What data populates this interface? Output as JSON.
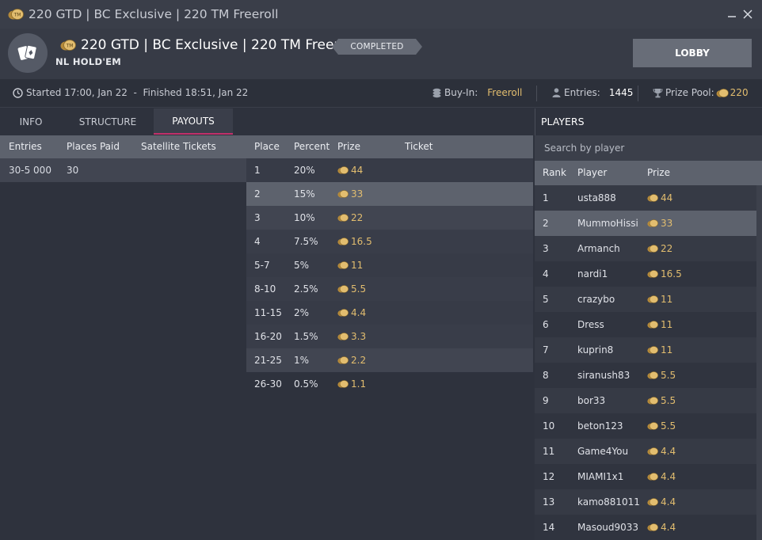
{
  "window": {
    "title": "220 GTD | BC Exclusive | 220 TM  Freeroll",
    "coin_label": "TM"
  },
  "header": {
    "title": "220 GTD | BC Exclusive | 220 TM  Freeroll",
    "status_badge": "COMPLETED",
    "game_type": "NL HOLD'EM",
    "lobby_label": "LOBBY"
  },
  "info": {
    "times": "Started 17:00, Jan 22  -  Finished 18:51, Jan 22",
    "buyin_label": "Buy-In:",
    "buyin_value": "Freeroll",
    "entries_label": "Entries:",
    "entries_value": "1445",
    "prize_pool_label": "Prize Pool:",
    "prize_pool_value": "220"
  },
  "tabs": [
    "INFO",
    "STRUCTURE",
    "PAYOUTS"
  ],
  "active_tab": "PAYOUTS",
  "payout_columns": {
    "entries": "Entries",
    "places_paid": "Places Paid",
    "satellite": "Satellite Tickets",
    "place": "Place",
    "percent": "Percent",
    "prize": "Prize",
    "ticket": "Ticket"
  },
  "entries_table": [
    {
      "entries": "30-5 000",
      "places_paid": "30",
      "satellite": ""
    }
  ],
  "payouts": [
    {
      "place": "1",
      "percent": "20%",
      "prize": "44"
    },
    {
      "place": "2",
      "percent": "15%",
      "prize": "33"
    },
    {
      "place": "3",
      "percent": "10%",
      "prize": "22"
    },
    {
      "place": "4",
      "percent": "7.5%",
      "prize": "16.5"
    },
    {
      "place": "5-7",
      "percent": "5%",
      "prize": "11"
    },
    {
      "place": "8-10",
      "percent": "2.5%",
      "prize": "5.5"
    },
    {
      "place": "11-15",
      "percent": "2%",
      "prize": "4.4"
    },
    {
      "place": "16-20",
      "percent": "1.5%",
      "prize": "3.3"
    },
    {
      "place": "21-25",
      "percent": "1%",
      "prize": "2.2"
    },
    {
      "place": "26-30",
      "percent": "0.5%",
      "prize": "1.1"
    }
  ],
  "players_panel": {
    "title": "PLAYERS",
    "search_placeholder": "Search by player",
    "columns": {
      "rank": "Rank",
      "player": "Player",
      "prize": "Prize"
    },
    "rows": [
      {
        "rank": "1",
        "player": "usta888",
        "prize": "44"
      },
      {
        "rank": "2",
        "player": "MummoHissi",
        "prize": "33"
      },
      {
        "rank": "3",
        "player": "Armanch",
        "prize": "22"
      },
      {
        "rank": "4",
        "player": "nardi1",
        "prize": "16.5"
      },
      {
        "rank": "5",
        "player": "crazybo",
        "prize": "11"
      },
      {
        "rank": "6",
        "player": "Dress",
        "prize": "11"
      },
      {
        "rank": "7",
        "player": "kuprin8",
        "prize": "11"
      },
      {
        "rank": "8",
        "player": "siranush83",
        "prize": "5.5"
      },
      {
        "rank": "9",
        "player": "bor33",
        "prize": "5.5"
      },
      {
        "rank": "10",
        "player": "beton123",
        "prize": "5.5"
      },
      {
        "rank": "11",
        "player": "Game4You",
        "prize": "4.4"
      },
      {
        "rank": "12",
        "player": "MIAMI1x1",
        "prize": "4.4"
      },
      {
        "rank": "13",
        "player": "kamo881011",
        "prize": "4.4"
      },
      {
        "rank": "14",
        "player": "Masoud9033",
        "prize": "4.4"
      }
    ]
  },
  "colors": {
    "accent_gold": "#e2bd6f",
    "tab_underline": "#c0306a",
    "highlight_row": "#5d626d"
  }
}
